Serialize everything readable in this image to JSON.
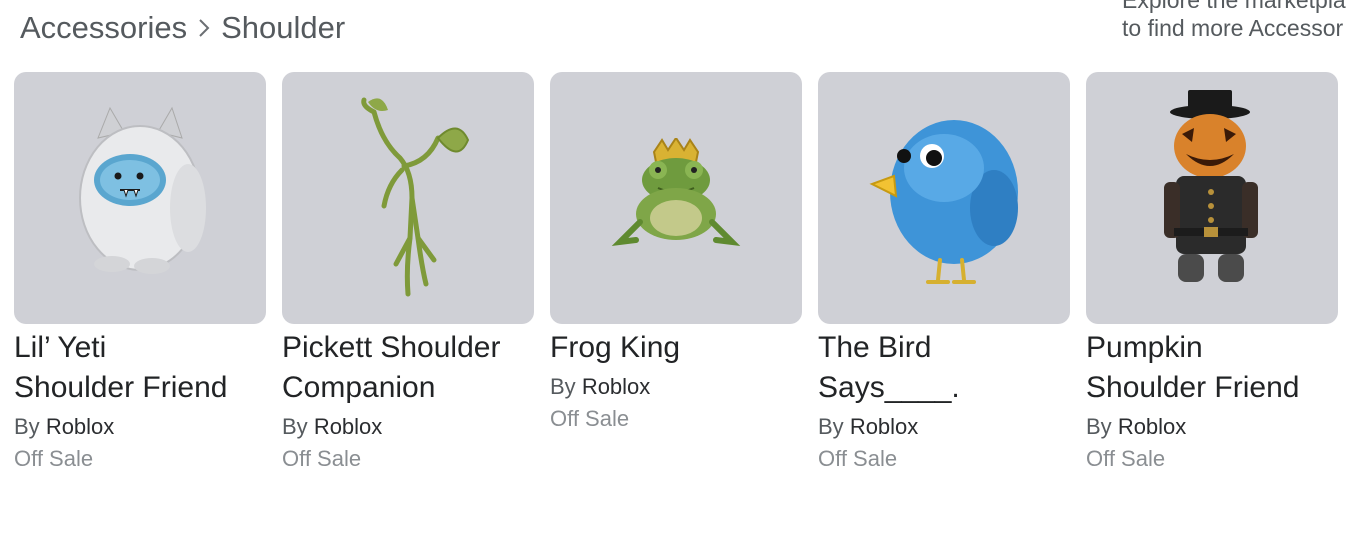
{
  "breadcrumb": {
    "category": "Accessories",
    "subcategory": "Shoulder"
  },
  "promo": {
    "line1": "Explore the marketpla",
    "line2": "to find more Accessor"
  },
  "items": [
    {
      "name": "Lil’ Yeti\nShoulder Friend",
      "by_label": "By",
      "creator": "Roblox",
      "price": "Off Sale",
      "icon": "yeti-icon"
    },
    {
      "name": "Pickett Shoulder\nCompanion",
      "by_label": "By",
      "creator": "Roblox",
      "price": "Off Sale",
      "icon": "pickett-icon"
    },
    {
      "name": "Frog King",
      "by_label": "By",
      "creator": "Roblox",
      "price": "Off Sale",
      "icon": "frog-king-icon"
    },
    {
      "name": "The Bird\nSays____.",
      "by_label": "By",
      "creator": "Roblox",
      "price": "Off Sale",
      "icon": "bird-icon"
    },
    {
      "name": "Pumpkin\nShoulder Friend",
      "by_label": "By",
      "creator": "Roblox",
      "price": "Off Sale",
      "icon": "pumpkin-icon"
    }
  ],
  "colors": {
    "thumb_bg": "#cfd0d6",
    "muted_text": "#8a8e92",
    "title_text": "#222426"
  }
}
